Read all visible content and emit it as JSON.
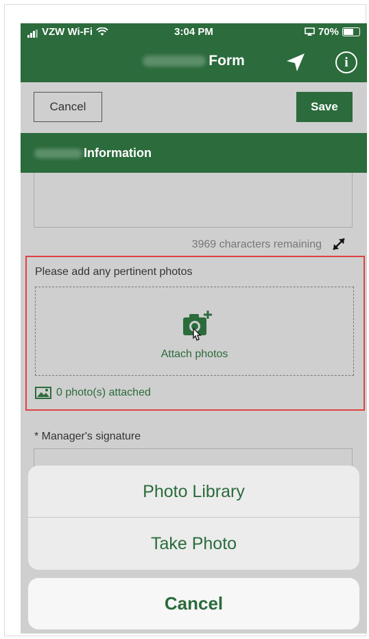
{
  "status": {
    "carrier": "VZW Wi-Fi",
    "time": "3:04 PM",
    "battery": "70%"
  },
  "nav": {
    "title": "Form",
    "arrow_icon": "location-arrow-icon",
    "info_icon": "info-icon",
    "info_glyph": "i"
  },
  "toolbar": {
    "cancel_label": "Cancel",
    "save_label": "Save"
  },
  "section": {
    "title": "Information"
  },
  "description": {
    "chars_remaining": "3969 characters remaining"
  },
  "photos": {
    "prompt": "Please add any pertinent photos",
    "attach_label": "Attach photos",
    "count_label": "0 photo(s) attached"
  },
  "signature": {
    "label": "* Manager's signature"
  },
  "action_sheet": {
    "options": [
      "Photo Library",
      "Take Photo"
    ],
    "cancel_label": "Cancel"
  },
  "colors": {
    "brand_green": "#2b6b3c",
    "highlight_red": "#e04040"
  }
}
